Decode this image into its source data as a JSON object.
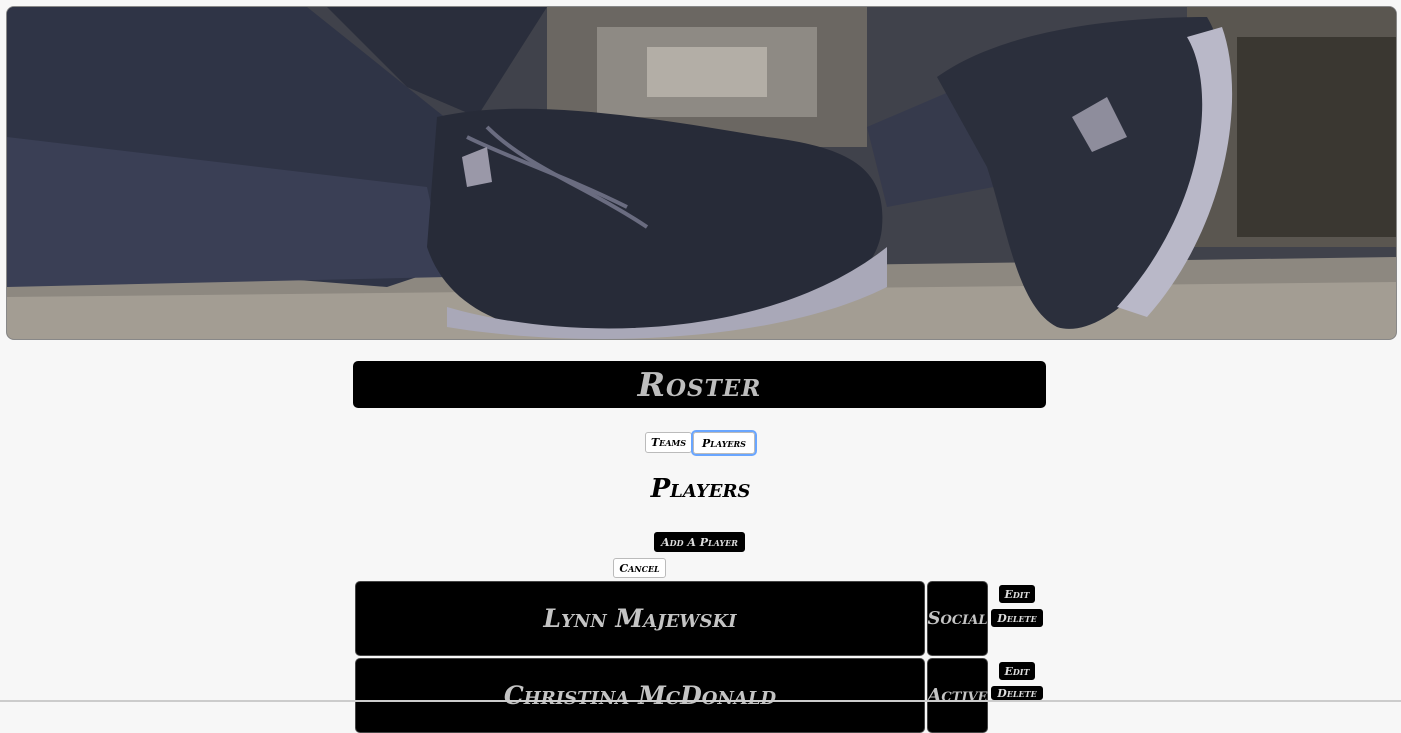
{
  "header": {
    "title": "Roster"
  },
  "nav": {
    "teams_label": "Teams",
    "players_label": "Players"
  },
  "section": {
    "title": "Players",
    "add_label": "Add A Player",
    "cancel_label": "Cancel"
  },
  "players": [
    {
      "name": "Lynn Majewski",
      "status": "Social",
      "edit_label": "Edit",
      "delete_label": "Delete"
    },
    {
      "name": "Christina McDonald",
      "status": "Active",
      "edit_label": "Edit",
      "delete_label": "Delete"
    }
  ],
  "colors": {
    "row_bg": "#000000",
    "row_text": "#c4c4c4",
    "focus_ring": "#6aa6ff"
  },
  "hero": {
    "alt": "sneakers-photo"
  }
}
